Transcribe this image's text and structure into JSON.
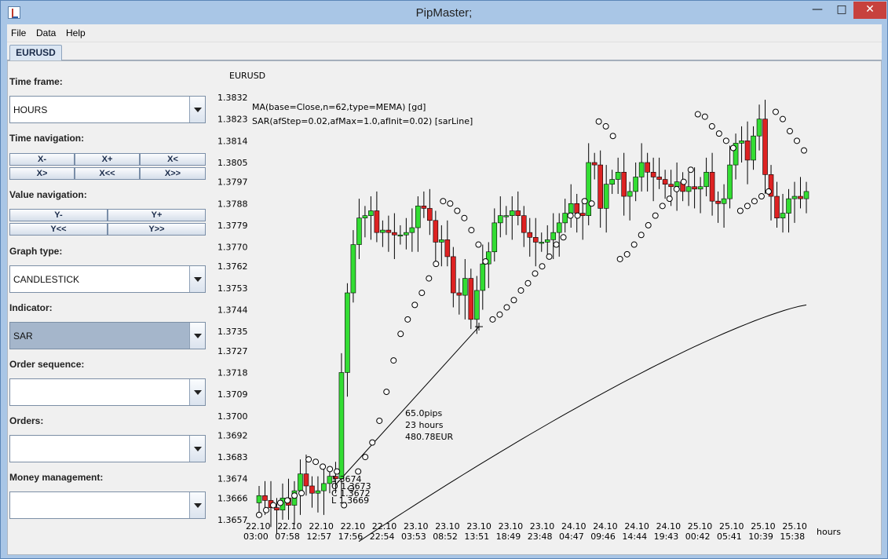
{
  "window": {
    "title": "PipMaster;"
  },
  "menu": [
    "File",
    "Data",
    "Help"
  ],
  "tab": "EURUSD",
  "panel": {
    "time_frame_label": "Time frame:",
    "time_frame_value": "HOURS",
    "time_nav_label": "Time navigation:",
    "time_nav_buttons": [
      "X-",
      "X+",
      "X<",
      "X>",
      "X<<",
      "X>>"
    ],
    "value_nav_label": "Value navigation:",
    "value_nav_buttons": [
      "Y-",
      "Y+",
      "Y<<",
      "Y>>"
    ],
    "graph_type_label": "Graph type:",
    "graph_type_value": "CANDLESTICK",
    "indicator_label": "Indicator:",
    "indicator_value": "SAR",
    "order_seq_label": "Order sequence:",
    "order_seq_value": "",
    "orders_label": "Orders:",
    "orders_value": "",
    "money_label": "Money management:",
    "money_value": ""
  },
  "chart_data": {
    "type": "candlestick",
    "title": "EURUSD",
    "xlabel": "hours",
    "ylim": [
      1.3657,
      1.3832
    ],
    "y_ticks": [
      "1.3832",
      "1.3823",
      "1.3814",
      "1.3805",
      "1.3797",
      "1.3788",
      "1.3779",
      "1.3770",
      "1.3762",
      "1.3753",
      "1.3744",
      "1.3735",
      "1.3727",
      "1.3718",
      "1.3709",
      "1.3700",
      "1.3692",
      "1.3683",
      "1.3674",
      "1.3666",
      "1.3657"
    ],
    "x_ticks": [
      {
        "d": "22.10",
        "t": "03:00"
      },
      {
        "d": "22.10",
        "t": "07:58"
      },
      {
        "d": "22.10",
        "t": "12:57"
      },
      {
        "d": "22.10",
        "t": "17:56"
      },
      {
        "d": "22.10",
        "t": "22:54"
      },
      {
        "d": "23.10",
        "t": "03:53"
      },
      {
        "d": "23.10",
        "t": "08:52"
      },
      {
        "d": "23.10",
        "t": "13:51"
      },
      {
        "d": "23.10",
        "t": "18:49"
      },
      {
        "d": "23.10",
        "t": "23:48"
      },
      {
        "d": "24.10",
        "t": "04:47"
      },
      {
        "d": "24.10",
        "t": "09:46"
      },
      {
        "d": "24.10",
        "t": "14:44"
      },
      {
        "d": "24.10",
        "t": "19:43"
      },
      {
        "d": "25.10",
        "t": "00:42"
      },
      {
        "d": "25.10",
        "t": "05:41"
      },
      {
        "d": "25.10",
        "t": "10:39"
      },
      {
        "d": "25.10",
        "t": "15:38"
      }
    ],
    "indicator_labels": [
      "MA(base=Close,n=62,type=MEMA) [gd]",
      "SAR(afStep=0.02,afMax=1.0,afInit=0.02) [sarLine]"
    ],
    "measure": [
      "65.0pips",
      "23 hours",
      "480.78EUR"
    ],
    "ohlc_labels": [
      "1.3674",
      "1.3673",
      "1.3672",
      "1.3669"
    ],
    "ohlc_prefixes": [
      "",
      "O",
      "C",
      "L"
    ],
    "candle_close": [
      1.3667,
      1.3665,
      1.3662,
      1.3661,
      1.3666,
      1.3663,
      1.3669,
      1.3676,
      1.3671,
      1.3668,
      1.3669,
      1.3672,
      1.3675,
      1.3674,
      1.3718,
      1.3751,
      1.3771,
      1.3782,
      1.3783,
      1.3785,
      1.3776,
      1.3777,
      1.3776,
      1.3775,
      1.3775,
      1.3776,
      1.3778,
      1.3787,
      1.3786,
      1.3781,
      1.3772,
      1.3773,
      1.3766,
      1.3751,
      1.375,
      1.3757,
      1.374,
      1.3752,
      1.3763,
      1.3768,
      1.378,
      1.3783,
      1.3783,
      1.3785,
      1.3783,
      1.3776,
      1.3774,
      1.3772,
      1.3772,
      1.3773,
      1.3776,
      1.378,
      1.3784,
      1.3788,
      1.3784,
      1.3783,
      1.3805,
      1.3804,
      1.3786,
      1.3796,
      1.3798,
      1.3801,
      1.3791,
      1.3793,
      1.3799,
      1.3805,
      1.3801,
      1.3799,
      1.3798,
      1.3796,
      1.3795,
      1.3797,
      1.3793,
      1.3795,
      1.3794,
      1.3795,
      1.3801,
      1.3789,
      1.3788,
      1.379,
      1.3804,
      1.3813,
      1.3814,
      1.3806,
      1.3816,
      1.3823,
      1.38,
      1.3791,
      1.3782,
      1.3784,
      1.379,
      1.3791,
      1.379,
      1.3793
    ],
    "sar_points": [
      1.3659,
      1.3661,
      1.3663,
      1.3664,
      1.3665,
      1.3667,
      1.3668,
      1.3682,
      1.3681,
      1.3679,
      1.3678,
      1.3677,
      1.3663,
      1.367,
      1.3677,
      1.3683,
      1.3689,
      1.3698,
      1.371,
      1.3723,
      1.3734,
      1.374,
      1.3746,
      1.3751,
      1.3757,
      1.3763,
      1.3789,
      1.3788,
      1.3785,
      1.3782,
      1.3777,
      1.3771,
      1.3764,
      1.374,
      1.3742,
      1.3745,
      1.3748,
      1.3752,
      1.3755,
      1.3759,
      1.3762,
      1.3766,
      1.3771,
      1.3774,
      1.3783,
      1.3783,
      1.3789,
      1.3788,
      1.3822,
      1.382,
      1.3816,
      1.3765,
      1.3767,
      1.3771,
      1.3775,
      1.3779,
      1.3783,
      1.3787,
      1.379,
      1.3794,
      1.3797,
      1.3802,
      1.3825,
      1.3824,
      1.382,
      1.3817,
      1.3814,
      1.3811,
      1.3785,
      1.3787,
      1.3789,
      1.3791,
      1.3793,
      1.3826,
      1.3823,
      1.3818,
      1.3814,
      1.381
    ],
    "ma_line": [
      [
        120,
        1.363
      ],
      [
        300,
        1.3668
      ],
      [
        500,
        1.37
      ],
      [
        700,
        1.3728
      ],
      [
        850,
        1.3745
      ],
      [
        1000,
        1.3745
      ]
    ]
  }
}
